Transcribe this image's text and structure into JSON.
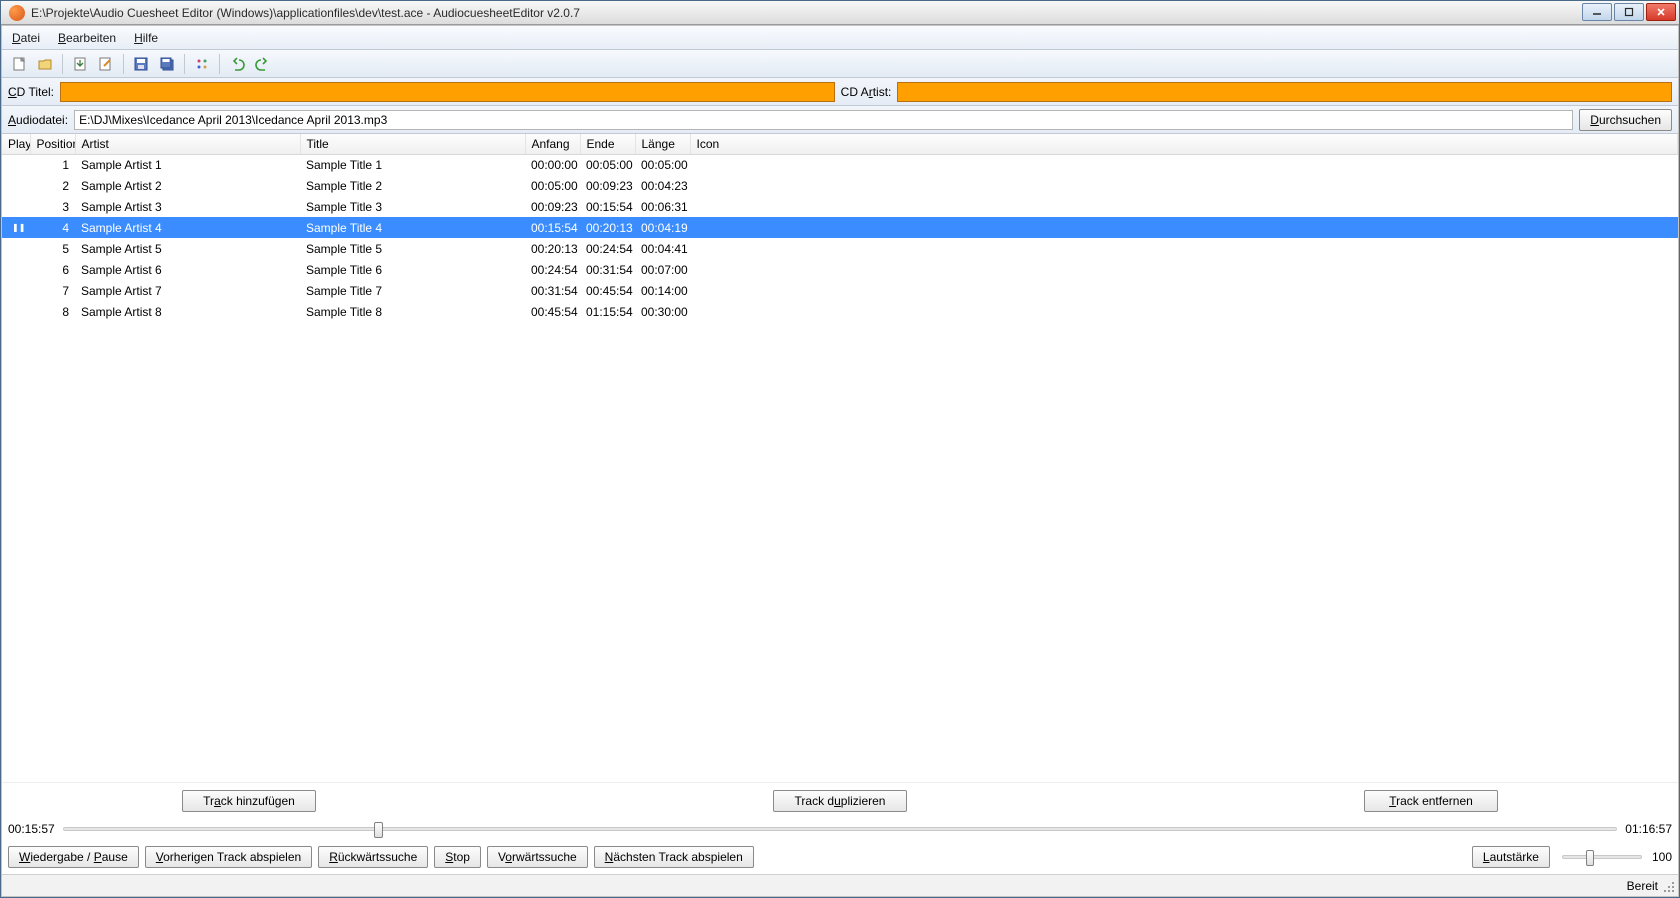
{
  "window": {
    "title": "E:\\Projekte\\Audio Cuesheet Editor (Windows)\\applicationfiles\\dev\\test.ace - AudiocuesheetEditor v2.0.7"
  },
  "menu": {
    "file": "Datei",
    "edit": "Bearbeiten",
    "help": "Hilfe"
  },
  "toolbar": {
    "new": "new-file-icon",
    "open": "open-folder-icon",
    "import": "import-icon",
    "edit": "edit-icon",
    "save": "save-icon",
    "saveall": "save-all-icon",
    "autofill": "autofill-icon",
    "undo": "undo-icon",
    "redo": "redo-icon"
  },
  "labels": {
    "cd_title": "CD Titel:",
    "cd_artist": "CD Artist:",
    "audiofile": "Audiodatei:",
    "browse": "Durchsuchen"
  },
  "fields": {
    "cd_title_value": "",
    "cd_artist_value": "",
    "audiofile_value": "E:\\DJ\\Mixes\\Icedance April 2013\\Icedance April 2013.mp3"
  },
  "columns": {
    "playing": "Playir",
    "position": "Position",
    "artist": "Artist",
    "title": "Title",
    "start": "Anfang",
    "end": "Ende",
    "length": "Länge",
    "icon": "Icon"
  },
  "tracks": [
    {
      "playing": "",
      "pos": "1",
      "artist": "Sample Artist 1",
      "title": "Sample Title 1",
      "start": "00:00:00",
      "end": "00:05:00",
      "length": "00:05:00",
      "selected": false
    },
    {
      "playing": "",
      "pos": "2",
      "artist": "Sample Artist 2",
      "title": "Sample Title 2",
      "start": "00:05:00",
      "end": "00:09:23",
      "length": "00:04:23",
      "selected": false
    },
    {
      "playing": "",
      "pos": "3",
      "artist": "Sample Artist 3",
      "title": "Sample Title 3",
      "start": "00:09:23",
      "end": "00:15:54",
      "length": "00:06:31",
      "selected": false
    },
    {
      "playing": "❚❚",
      "pos": "4",
      "artist": "Sample Artist 4",
      "title": "Sample Title 4",
      "start": "00:15:54",
      "end": "00:20:13",
      "length": "00:04:19",
      "selected": true
    },
    {
      "playing": "",
      "pos": "5",
      "artist": "Sample Artist 5",
      "title": "Sample Title 5",
      "start": "00:20:13",
      "end": "00:24:54",
      "length": "00:04:41",
      "selected": false
    },
    {
      "playing": "",
      "pos": "6",
      "artist": "Sample Artist 6",
      "title": "Sample Title 6",
      "start": "00:24:54",
      "end": "00:31:54",
      "length": "00:07:00",
      "selected": false
    },
    {
      "playing": "",
      "pos": "7",
      "artist": "Sample Artist 7",
      "title": "Sample Title 7",
      "start": "00:31:54",
      "end": "00:45:54",
      "length": "00:14:00",
      "selected": false
    },
    {
      "playing": "",
      "pos": "8",
      "artist": "Sample Artist 8",
      "title": "Sample Title 8",
      "start": "00:45:54",
      "end": "01:15:54",
      "length": "00:30:00",
      "selected": false
    }
  ],
  "track_actions": {
    "add": "Track hinzufügen",
    "dup": "Track duplizieren",
    "del": "Track entfernen"
  },
  "playback": {
    "time_current": "00:15:57",
    "time_total": "01:16:57",
    "slider_percent": 20,
    "buttons": {
      "playpause": "Wiedergabe / Pause",
      "prev": "Vorherigen Track abspielen",
      "seekback": "Rückwärtssuche",
      "stop": "Stop",
      "seekfwd": "Vorwärtssuche",
      "next": "Nächsten Track abspielen",
      "volume": "Lautstärke"
    },
    "volume_value": "100",
    "volume_percent": 30
  },
  "status": {
    "text": "Bereit"
  }
}
